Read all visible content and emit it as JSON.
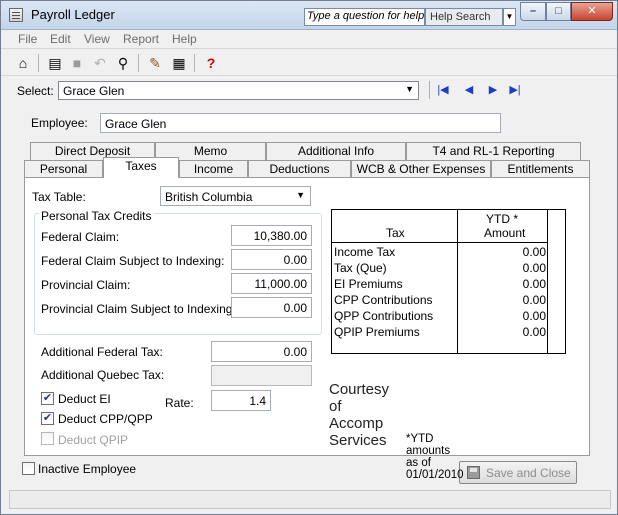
{
  "window": {
    "title": "Payroll Ledger",
    "help_placeholder": "Type a question for help",
    "help_search_label": "Help Search"
  },
  "menu": [
    "File",
    "Edit",
    "View",
    "Report",
    "Help"
  ],
  "toolbar": {
    "icons": [
      "home-icon",
      "open-icon",
      "save-icon",
      "undo-icon",
      "view-icon",
      "edit-icon",
      "report-icon",
      "help-icon"
    ]
  },
  "select": {
    "label": "Select:",
    "value": "Grace Glen"
  },
  "employee": {
    "label": "Employee:",
    "value": "Grace Glen"
  },
  "tabs": {
    "row1": [
      "Direct Deposit",
      "Memo",
      "Additional Info",
      "T4 and RL-1 Reporting"
    ],
    "row2": [
      "Personal",
      "Taxes",
      "Income",
      "Deductions",
      "WCB & Other Expenses",
      "Entitlements"
    ],
    "active": "Taxes"
  },
  "taxes": {
    "tax_table_label": "Tax Table:",
    "tax_table_value": "British Columbia",
    "credits_title": "Personal Tax Credits",
    "federal_claim_label": "Federal Claim:",
    "federal_claim_value": "10,380.00",
    "federal_indexing_label": "Federal Claim Subject to Indexing:",
    "federal_indexing_value": "0.00",
    "provincial_claim_label": "Provincial Claim:",
    "provincial_claim_value": "11,000.00",
    "provincial_indexing_label": "Provincial Claim Subject to Indexing:",
    "provincial_indexing_value": "0.00",
    "additional_federal_label": "Additional Federal Tax:",
    "additional_federal_value": "0.00",
    "additional_quebec_label": "Additional Quebec Tax:",
    "additional_quebec_value": "",
    "deduct_ei_label": "Deduct EI",
    "deduct_ei_checked": true,
    "deduct_cpp_label": "Deduct CPP/QPP",
    "deduct_cpp_checked": true,
    "deduct_qpip_label": "Deduct QPIP",
    "deduct_qpip_checked": false,
    "rate_label": "Rate:",
    "rate_value": "1.4"
  },
  "ytd": {
    "col_tax": "Tax",
    "col_amount_line1": "YTD *",
    "col_amount_line2": "Amount",
    "rows": [
      {
        "tax": "Income Tax",
        "amount": "0.00"
      },
      {
        "tax": "Tax (Que)",
        "amount": "0.00"
      },
      {
        "tax": "EI Premiums",
        "amount": "0.00"
      },
      {
        "tax": "CPP Contributions",
        "amount": "0.00"
      },
      {
        "tax": "QPP Contributions",
        "amount": "0.00"
      },
      {
        "tax": "QPIP Premiums",
        "amount": "0.00"
      }
    ],
    "note": "*YTD amounts as of 01/01/2010"
  },
  "courtesy": "Courtesy of Accomp Services",
  "footer": {
    "inactive_label": "Inactive Employee",
    "inactive_checked": false,
    "save_close_label": "Save and Close"
  }
}
